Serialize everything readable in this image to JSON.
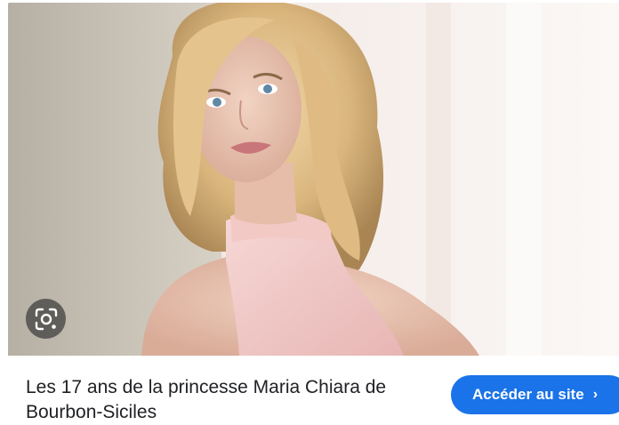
{
  "image_result": {
    "photo_alt": "Blonde woman with wavy hair wearing a pink halter top leaning against a wall",
    "lens_icon": "google-lens-icon"
  },
  "caption": {
    "title": "Les 17 ans de la princesse Maria Chiara de Bourbon-Siciles"
  },
  "actions": {
    "visit_label": "Accéder au site",
    "visit_chevron": "›"
  },
  "colors": {
    "accent": "#1a73e8",
    "text": "#202124",
    "lens_bg": "#3c3c3c"
  }
}
